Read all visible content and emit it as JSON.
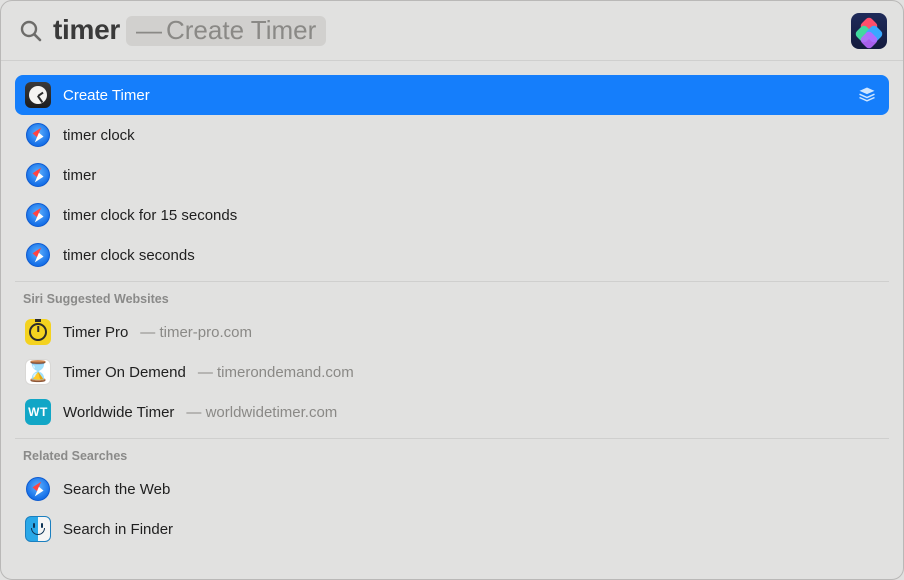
{
  "search": {
    "query": "timer",
    "suggestion_dash": "—",
    "suggestion": "Create Timer"
  },
  "top_hits": [
    {
      "icon": "clock",
      "label": "Create Timer",
      "selected": true
    },
    {
      "icon": "safari",
      "label": "timer clock",
      "selected": false
    },
    {
      "icon": "safari",
      "label": "timer",
      "selected": false
    },
    {
      "icon": "safari",
      "label": "timer clock for 15 seconds",
      "selected": false
    },
    {
      "icon": "safari",
      "label": "timer clock seconds",
      "selected": false
    }
  ],
  "sections": [
    {
      "title": "Siri Suggested Websites",
      "items": [
        {
          "icon": "stopwatch",
          "label": "Timer Pro",
          "sub": " — timer-pro.com"
        },
        {
          "icon": "hourglass",
          "label": "Timer On Demend",
          "sub": " — timerondemand.com"
        },
        {
          "icon": "wt",
          "label": "Worldwide Timer",
          "sub": " — worldwidetimer.com"
        }
      ]
    },
    {
      "title": "Related Searches",
      "items": [
        {
          "icon": "safari",
          "label": "Search the Web"
        },
        {
          "icon": "finder",
          "label": "Search in Finder"
        }
      ]
    }
  ]
}
